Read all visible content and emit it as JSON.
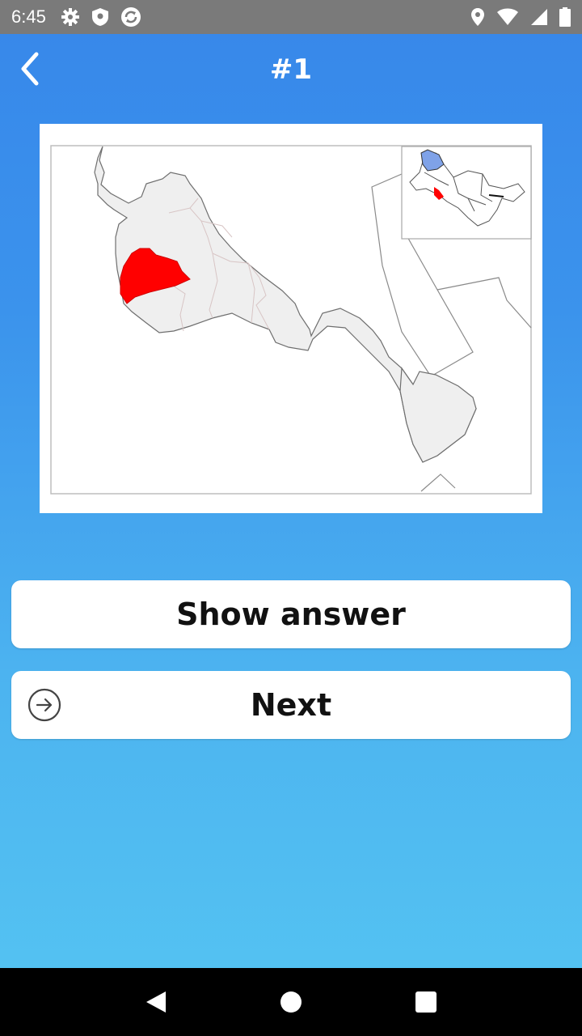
{
  "status_bar": {
    "time": "6:45",
    "left_icons": [
      "settings-icon",
      "shield-icon",
      "sync-icon"
    ],
    "right_icons": [
      "location-icon",
      "wifi-icon",
      "signal-icon",
      "battery-icon"
    ]
  },
  "app_bar": {
    "title": "#1",
    "back_icon": "chevron-left-icon"
  },
  "map": {
    "highlight_color": "#ff0000",
    "inset_highlight_color": "#7fa2e8",
    "land_color": "#efefef"
  },
  "buttons": {
    "show_answer_label": "Show answer",
    "next_label": "Next",
    "next_icon": "arrow-right-circle-icon"
  },
  "nav_bar": {
    "icons": [
      "back-triangle-icon",
      "home-circle-icon",
      "recents-square-icon"
    ]
  },
  "colors": {
    "status_bar": "#7a7a7a",
    "gradient_top": "#3787ea",
    "gradient_bottom": "#55c5f2",
    "button_bg": "#ffffff"
  }
}
